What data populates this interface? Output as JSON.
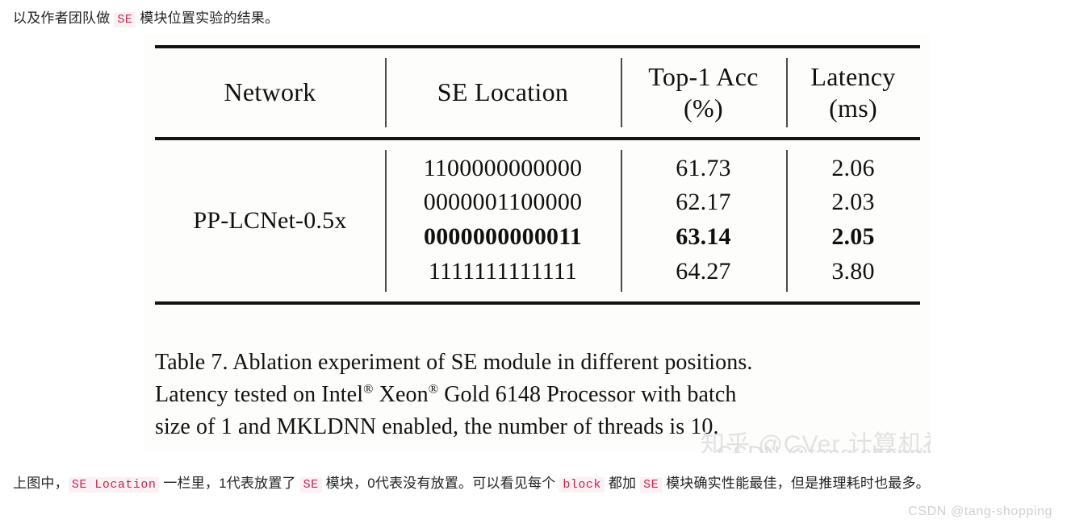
{
  "intro_paragraph": {
    "part1": "以及作者团队做 ",
    "code1": "SE",
    "part2": " 模块位置实验的结果。"
  },
  "figure": {
    "table": {
      "headers": [
        {
          "main": "Network",
          "sub": ""
        },
        {
          "main": "SE Location",
          "sub": ""
        },
        {
          "main": "Top-1 Acc",
          "sub": "(%)"
        },
        {
          "main": "Latency",
          "sub": "(ms)"
        }
      ],
      "network": "PP-LCNet-0.5x",
      "rows": [
        {
          "se_location": "1100000000000",
          "top1_acc": "61.73",
          "latency": "2.06",
          "bold": false
        },
        {
          "se_location": "0000001100000",
          "top1_acc": "62.17",
          "latency": "2.03",
          "bold": false
        },
        {
          "se_location": "0000000000011",
          "top1_acc": "63.14",
          "latency": "2.05",
          "bold": true
        },
        {
          "se_location": "1111111111111",
          "top1_acc": "64.27",
          "latency": "3.80",
          "bold": false
        }
      ]
    },
    "caption": {
      "line1": "Table 7. Ablation experiment of SE module in different positions.",
      "line2_a": "Latency tested on Intel",
      "line2_reg1": "®",
      "line2_b": " Xeon",
      "line2_reg2": "®",
      "line2_c": " Gold 6148 Processor with batch",
      "line3": "size of 1 and MKLDNN enabled, the number of threads is 10."
    },
    "watermark_zhihu": "知乎 @CVer 计算机视觉",
    "watermark_csdn": "CSDN @tang-shopping"
  },
  "outro_paragraph": {
    "part1": "上图中，",
    "code1": "SE Location",
    "part2": " 一栏里，1代表放置了 ",
    "code2": "SE",
    "part3": " 模块，0代表没有放置。可以看见每个 ",
    "code3": "block",
    "part4": " 都加 ",
    "code4": "SE",
    "part5": " 模块确实性能最佳，但是推理耗时也最多。"
  },
  "page_watermark": "CSDN @tang-shopping",
  "colors": {
    "code_text": "#c7254e",
    "code_bg": "#fbf0f3",
    "rule": "#15150f",
    "figure_bg": "#fdfdfc"
  }
}
